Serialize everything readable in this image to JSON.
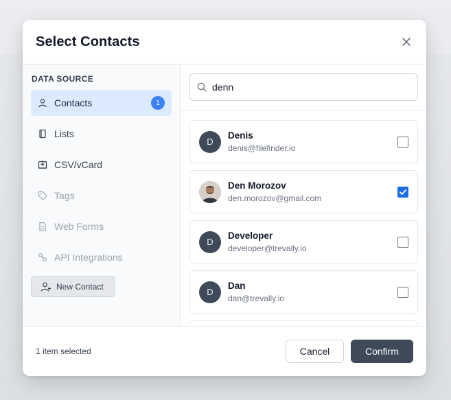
{
  "modal": {
    "title": "Select Contacts",
    "close_icon": "close-icon"
  },
  "sidebar": {
    "section_label": "DATA SOURCE",
    "items": [
      {
        "label": "Contacts",
        "icon": "user-icon",
        "active": true,
        "badge": "1"
      },
      {
        "label": "Lists",
        "icon": "list-book-icon",
        "active": false
      },
      {
        "label": "CSV/vCard",
        "icon": "import-icon",
        "active": false
      },
      {
        "label": "Tags",
        "icon": "tag-icon",
        "disabled": true
      },
      {
        "label": "Web Forms",
        "icon": "document-icon",
        "disabled": true
      },
      {
        "label": "API Integrations",
        "icon": "link-icon",
        "disabled": true
      }
    ],
    "new_contact_label": "New Contact"
  },
  "search": {
    "value": "denn",
    "icon": "search-icon"
  },
  "contacts": [
    {
      "name": "Denis",
      "email": "denis@filefinder.io",
      "initial": "D",
      "checked": false,
      "photo": false
    },
    {
      "name": "Den Morozov",
      "email": "den.morozov@gmail.com",
      "initial": "",
      "checked": true,
      "photo": true
    },
    {
      "name": "Developer",
      "email": "developer@trevally.io",
      "initial": "D",
      "checked": false,
      "photo": false
    },
    {
      "name": "Dan",
      "email": "dan@trevally.io",
      "initial": "D",
      "checked": false,
      "photo": false
    }
  ],
  "footer": {
    "selected_text": "1 item selected",
    "cancel_label": "Cancel",
    "confirm_label": "Confirm"
  },
  "colors": {
    "accent": "#3b82f6",
    "active_bg": "#dbeafe",
    "primary_button": "#3f4a59",
    "checkbox_checked": "#1d6fe0"
  }
}
